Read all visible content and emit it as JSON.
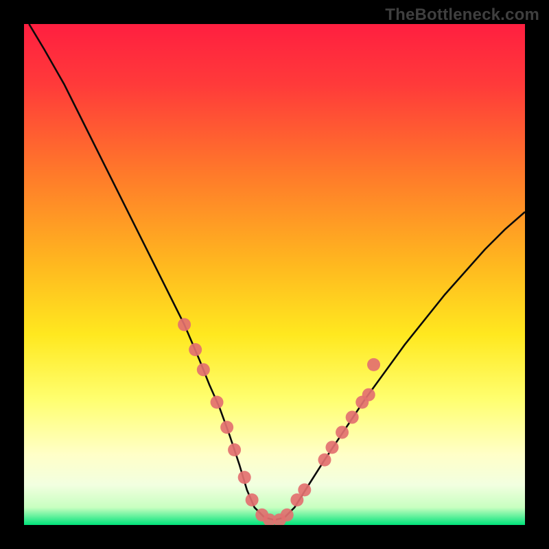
{
  "watermark": "TheBottleneck.com",
  "colors": {
    "bg": "#000000",
    "gradient_top": "#ff1f40",
    "gradient_mid1": "#ff9a1f",
    "gradient_mid2": "#ffe81f",
    "gradient_mid3": "#ffffa0",
    "gradient_mid4": "#f8ffd0",
    "gradient_bottom": "#00e37a",
    "curve_stroke": "#0a0a0a",
    "marker_fill": "#e37070",
    "watermark_text": "#3f3f3f"
  },
  "chart_data": {
    "type": "line",
    "title": "",
    "xlabel": "",
    "ylabel": "",
    "xlim": [
      0,
      100
    ],
    "ylim": [
      0,
      100
    ],
    "x": [
      1,
      4,
      8,
      12,
      16,
      20,
      24,
      28,
      32,
      35,
      37,
      39,
      41,
      43,
      44.5,
      46,
      48,
      50,
      52,
      54,
      56.5,
      60,
      64,
      68,
      72,
      76,
      80,
      84,
      88,
      92,
      96,
      100
    ],
    "y": [
      100,
      95,
      88,
      80,
      72,
      64,
      56,
      48,
      40,
      33,
      28,
      23.5,
      18,
      12,
      7,
      3.5,
      1.5,
      1.0,
      1.5,
      3.5,
      7.5,
      13,
      19,
      25,
      30.5,
      36,
      41,
      46,
      50.5,
      55,
      59,
      62.5
    ],
    "markers": [
      {
        "x": 32.0,
        "y": 40.0
      },
      {
        "x": 34.2,
        "y": 35.0
      },
      {
        "x": 35.8,
        "y": 31.0
      },
      {
        "x": 38.5,
        "y": 24.5
      },
      {
        "x": 40.5,
        "y": 19.5
      },
      {
        "x": 42.0,
        "y": 15.0
      },
      {
        "x": 44.0,
        "y": 9.5
      },
      {
        "x": 45.5,
        "y": 5.0
      },
      {
        "x": 47.5,
        "y": 2.0
      },
      {
        "x": 49.0,
        "y": 1.0
      },
      {
        "x": 51.0,
        "y": 1.0
      },
      {
        "x": 52.5,
        "y": 2.0
      },
      {
        "x": 54.5,
        "y": 5.0
      },
      {
        "x": 56.0,
        "y": 7.0
      },
      {
        "x": 60.0,
        "y": 13.0
      },
      {
        "x": 61.5,
        "y": 15.5
      },
      {
        "x": 63.5,
        "y": 18.5
      },
      {
        "x": 65.5,
        "y": 21.5
      },
      {
        "x": 67.5,
        "y": 24.5
      },
      {
        "x": 68.8,
        "y": 26.0
      },
      {
        "x": 69.8,
        "y": 32.0
      }
    ]
  }
}
